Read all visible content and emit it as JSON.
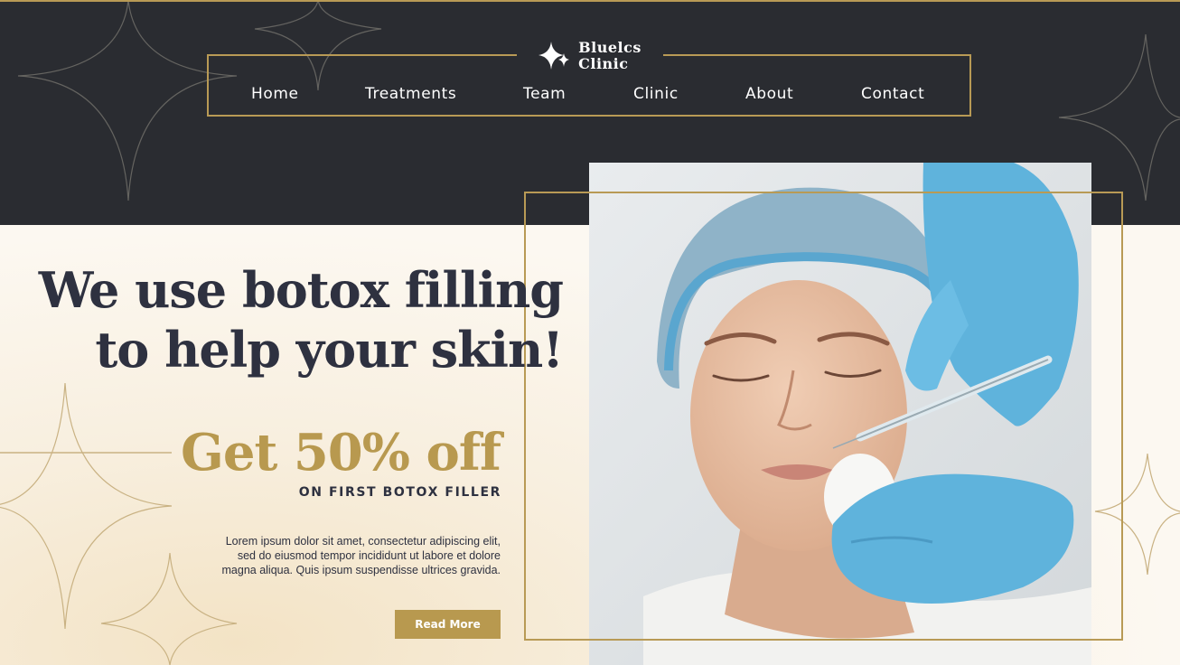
{
  "brand": {
    "name_line1": "Bluelcs",
    "name_line2": "Clinic"
  },
  "nav": {
    "items": [
      {
        "label": "Home"
      },
      {
        "label": "Treatments"
      },
      {
        "label": "Team"
      },
      {
        "label": "Clinic"
      },
      {
        "label": "About"
      },
      {
        "label": "Contact"
      }
    ]
  },
  "hero": {
    "headline_line1": "We use botox filling",
    "headline_line2": "to help your skin!",
    "offer_title": "Get 50% off",
    "offer_subtitle": "ON FIRST BOTOX FILLER",
    "body_line1": "Lorem ipsum dolor sit amet, consectetur adipiscing elit,",
    "body_line2": "sed do eiusmod tempor incididunt ut labore et dolore",
    "body_line3": "magna aliqua. Quis ipsum suspendisse ultrices gravida.",
    "cta_label": "Read More"
  },
  "colors": {
    "dark": "#2a2c31",
    "gold": "#b8994f",
    "cream": "#fbf7ef",
    "glove_blue": "#5fb3dc"
  }
}
